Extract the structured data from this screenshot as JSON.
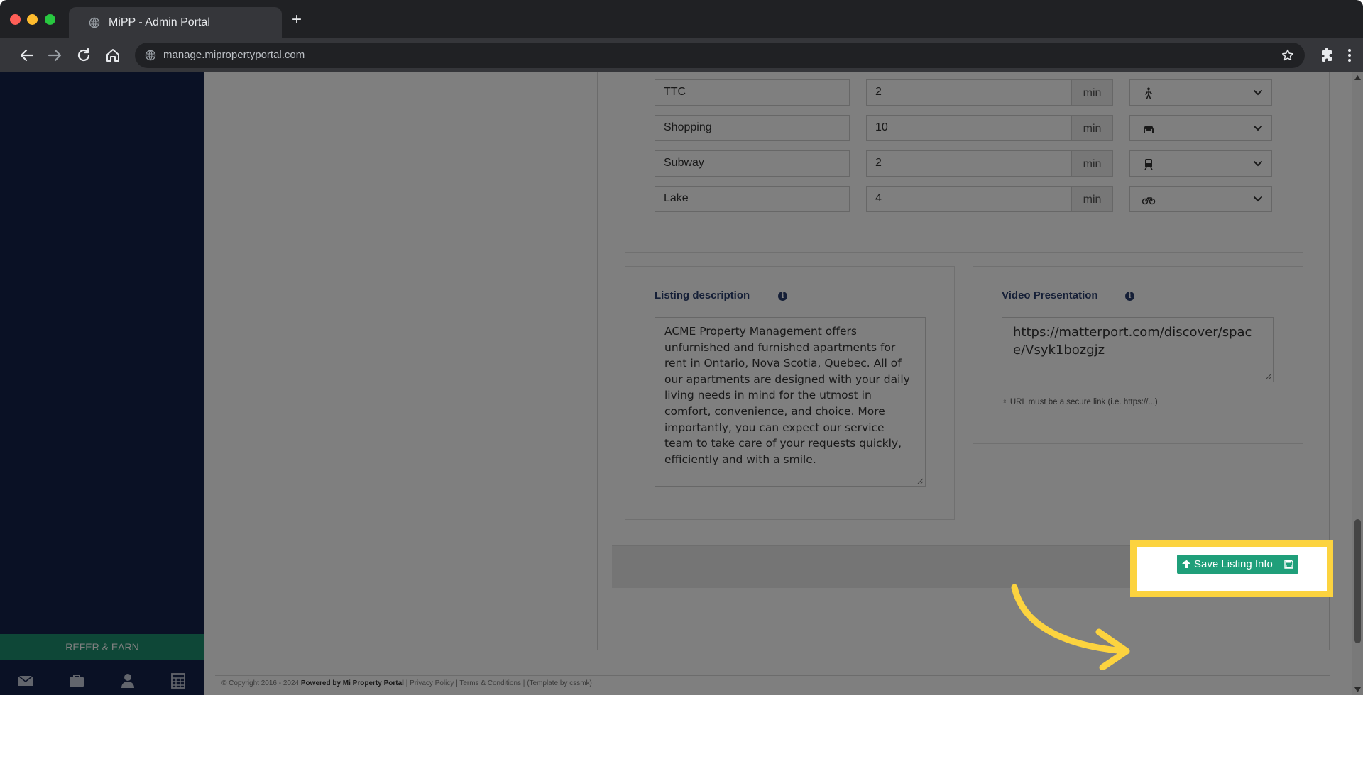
{
  "browser": {
    "tab_title": "MiPP - Admin Portal",
    "url": "manage.mipropertyportal.com",
    "traffic_colors": [
      "#ff5f57",
      "#febc2e",
      "#28c840"
    ]
  },
  "sidebar": {
    "refer_label": "REFER & EARN",
    "bottom_icons": [
      "mail-icon",
      "briefcase-icon",
      "user-icon",
      "calculator-icon"
    ],
    "background": "#15224a",
    "accent": "#1c8f6e"
  },
  "distances": {
    "unit_label": "min",
    "rows": [
      {
        "place": "TTC",
        "time": "2",
        "mode": "walk-icon"
      },
      {
        "place": "Shopping",
        "time": "10",
        "mode": "car-icon"
      },
      {
        "place": "Subway",
        "time": "2",
        "mode": "subway-icon"
      },
      {
        "place": "Lake",
        "time": "4",
        "mode": "bicycle-icon"
      }
    ]
  },
  "listing_description": {
    "label": "Listing description",
    "text": "ACME Property Management offers unfurnished and furnished apartments for rent in Ontario, Nova Scotia, Quebec. All of our apartments are designed with your daily living needs in mind for the utmost in comfort, convenience, and choice. More importantly, you can expect our service team to take care of your requests quickly, efficiently and with a smile."
  },
  "video_presentation": {
    "label": "Video Presentation",
    "value": "https://matterport.com/discover/space/Vsyk1bozgjz",
    "hint": "URL must be a secure link (i.e. https://...)"
  },
  "actions": {
    "save_label": "Save Listing Info",
    "save_color": "#1f9f7a",
    "highlight_color": "#fcd33f"
  },
  "footer": {
    "copyright_prefix": "© Copyright 2016 - 2024",
    "powered_by": "Powered by Mi Property Portal",
    "privacy": "Privacy Policy",
    "terms": "Terms & Conditions",
    "template_credit": "(Template by cssmk)"
  }
}
